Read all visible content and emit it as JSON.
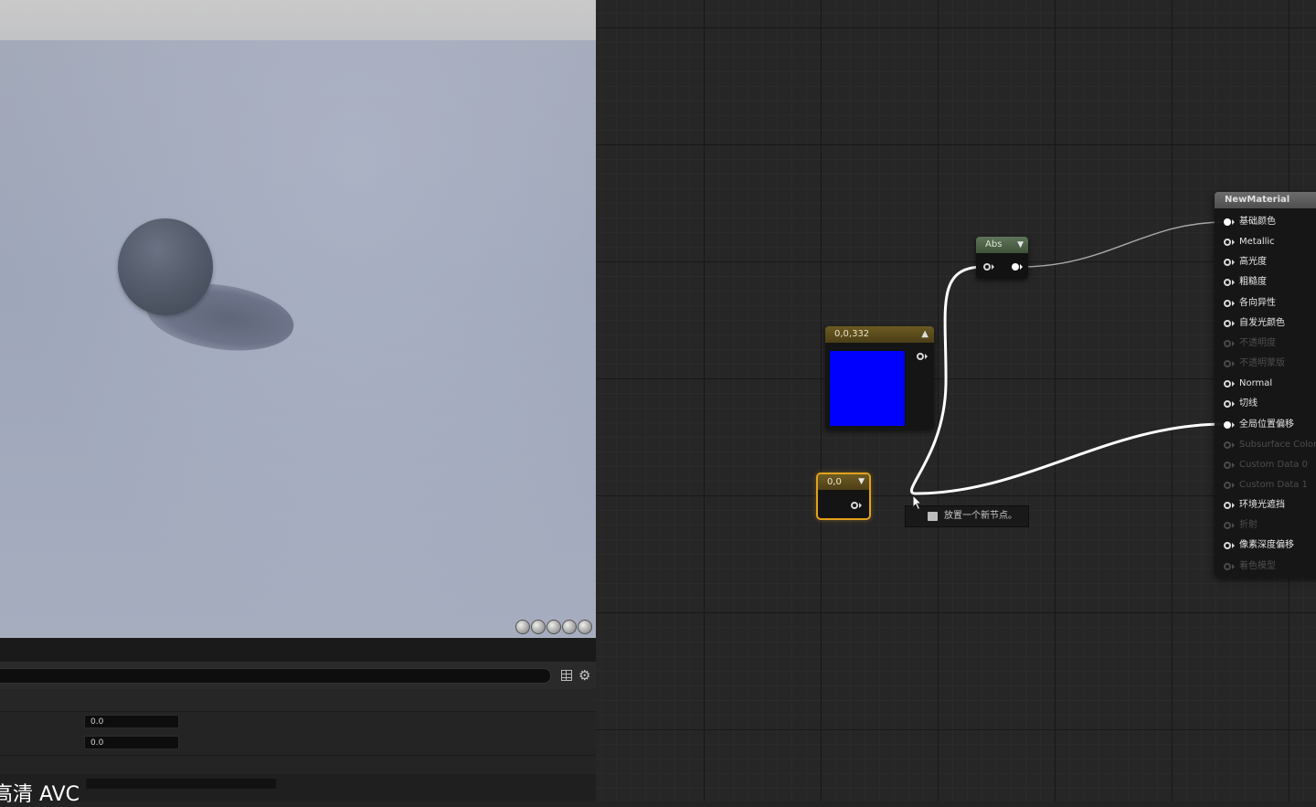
{
  "viewport": {
    "preview_buttons": [
      "cylinder-icon",
      "sphere-icon",
      "plane-icon",
      "cube-icon",
      "teapot-icon"
    ]
  },
  "lower_panel": {
    "fields": [
      "0.0",
      "0.0"
    ]
  },
  "watermark": "高清 AVC",
  "graph": {
    "color_node": {
      "title": "0,0,332",
      "swatch_color": "#0000ff"
    },
    "abs_node": {
      "title": "Abs"
    },
    "scalar_node": {
      "title": "0,0",
      "border_color": "#e2a21d"
    },
    "result_node": {
      "title": "NewMaterial",
      "inputs": [
        {
          "label": "基础颜色",
          "enabled": true,
          "connected": true
        },
        {
          "label": "Metallic",
          "enabled": true,
          "connected": false
        },
        {
          "label": "高光度",
          "enabled": true,
          "connected": false
        },
        {
          "label": "粗糙度",
          "enabled": true,
          "connected": false
        },
        {
          "label": "各向异性",
          "enabled": true,
          "connected": false
        },
        {
          "label": "自发光颜色",
          "enabled": true,
          "connected": false
        },
        {
          "label": "不透明度",
          "enabled": false,
          "connected": false
        },
        {
          "label": "不透明蒙版",
          "enabled": false,
          "connected": false
        },
        {
          "label": "Normal",
          "enabled": true,
          "connected": false
        },
        {
          "label": "切线",
          "enabled": true,
          "connected": false
        },
        {
          "label": "全局位置偏移",
          "enabled": true,
          "connected": true
        },
        {
          "label": "Subsurface Color",
          "enabled": false,
          "connected": false
        },
        {
          "label": "Custom Data 0",
          "enabled": false,
          "connected": false
        },
        {
          "label": "Custom Data 1",
          "enabled": false,
          "connected": false
        },
        {
          "label": "环境光遮挡",
          "enabled": true,
          "connected": false
        },
        {
          "label": "折射",
          "enabled": false,
          "connected": false
        },
        {
          "label": "像素深度偏移",
          "enabled": true,
          "connected": false
        },
        {
          "label": "着色模型",
          "enabled": false,
          "connected": false
        }
      ]
    },
    "tooltip": {
      "text": "放置一个新节点。"
    },
    "wire_color": "#ffffff"
  },
  "colors": {
    "editor_bg": "#262626",
    "constant_header": "#6b5a22",
    "abs_header": "#5f7559",
    "selection": "#e2a21d"
  }
}
